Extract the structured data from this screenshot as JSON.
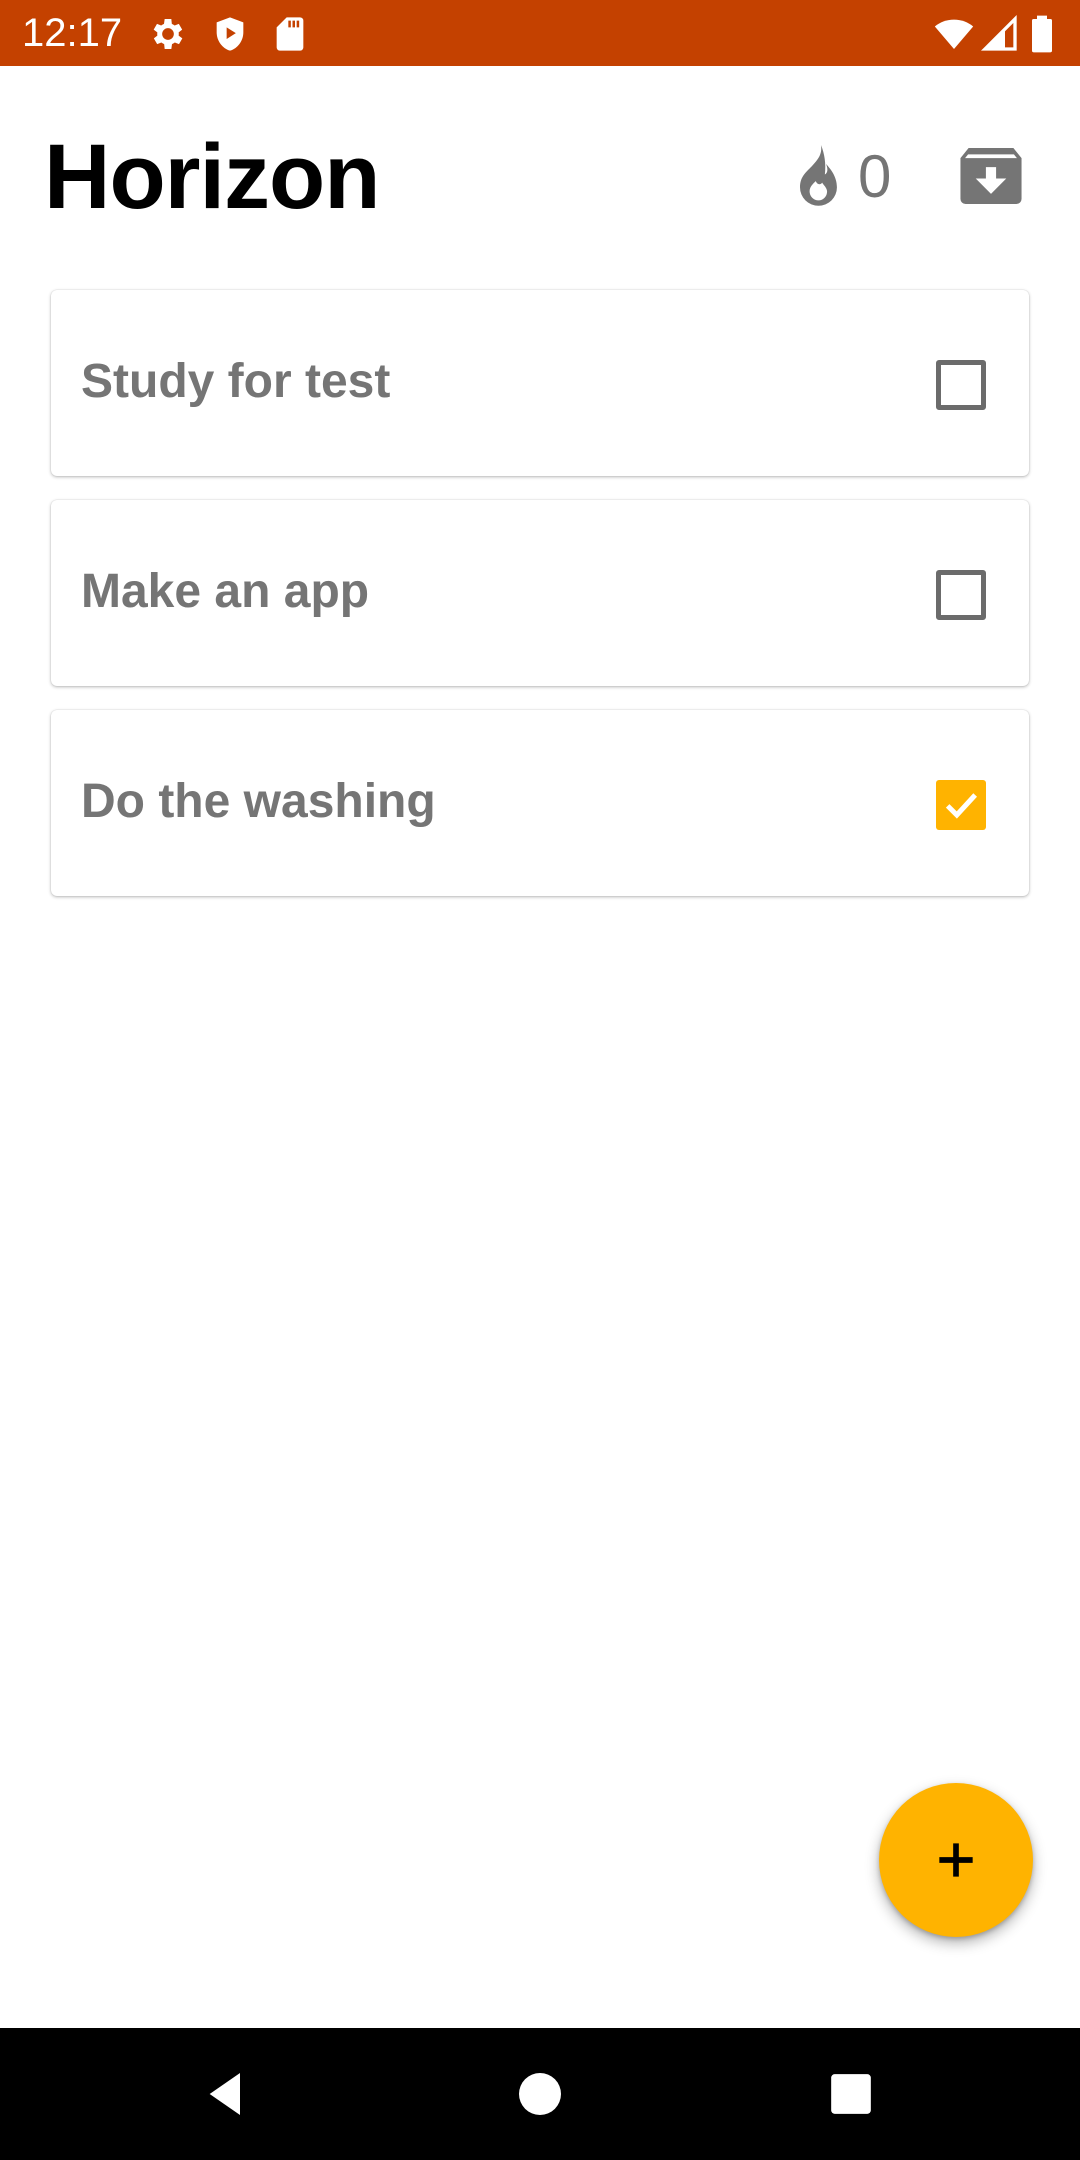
{
  "status_bar": {
    "time": "12:17",
    "icons": [
      "settings-icon",
      "shield-play-icon",
      "sd-card-icon",
      "wifi-icon",
      "signal-icon",
      "battery-icon"
    ],
    "background": "#c44100"
  },
  "header": {
    "title": "Horizon",
    "streak_icon": "flame-icon",
    "streak_count": "0",
    "archive_icon": "archive-icon"
  },
  "tasks": [
    {
      "label": "Study for test",
      "checked": false
    },
    {
      "label": "Make an app",
      "checked": false
    },
    {
      "label": "Do the washing",
      "checked": true
    }
  ],
  "fab": {
    "icon": "plus-icon",
    "color": "#ffb300"
  },
  "nav_bar": {
    "buttons": [
      "back-icon",
      "home-icon",
      "recents-icon"
    ]
  },
  "colors": {
    "accent": "#ffb300",
    "status_bar": "#c44100",
    "text_muted": "#757575"
  }
}
